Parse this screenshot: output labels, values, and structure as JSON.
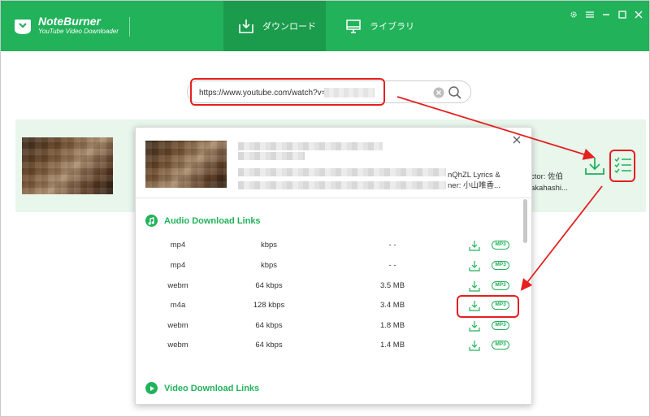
{
  "app": {
    "brand_name": "NoteBurner",
    "brand_sub": "YouTube Video Downloader"
  },
  "tabs": [
    {
      "label": "ダウンロード",
      "active": true
    },
    {
      "label": "ライブラリ",
      "active": false
    }
  ],
  "window_controls": [
    "gear-icon",
    "menu-icon",
    "minimize-icon",
    "maximize-icon",
    "close-icon"
  ],
  "search": {
    "value": "https://www.youtube.com/watch?v="
  },
  "result": {
    "meta_line1": "ctor: 佐伯",
    "meta_line2": "akahashi..."
  },
  "popup": {
    "title_tail_line1": "nQhZL Lyrics &",
    "title_tail_line2": "ner: 小山唯香...",
    "audio_section_title": "Audio Download Links",
    "video_section_title": "Video Download Links",
    "mp3_label": "MP3",
    "audio_links": [
      {
        "format": "mp4",
        "bitrate": "kbps",
        "size": "- -"
      },
      {
        "format": "mp4",
        "bitrate": "kbps",
        "size": "- -"
      },
      {
        "format": "webm",
        "bitrate": "64 kbps",
        "size": "3.5 MB"
      },
      {
        "format": "m4a",
        "bitrate": "128 kbps",
        "size": "3.4 MB"
      },
      {
        "format": "webm",
        "bitrate": "64 kbps",
        "size": "1.8 MB"
      },
      {
        "format": "webm",
        "bitrate": "64 kbps",
        "size": "1.4 MB"
      }
    ]
  },
  "colors": {
    "brand_green": "#21b25a",
    "tab_active": "#1a9c4c",
    "row_bg": "#e8f6ec",
    "annotation_red": "#e61f1f"
  }
}
